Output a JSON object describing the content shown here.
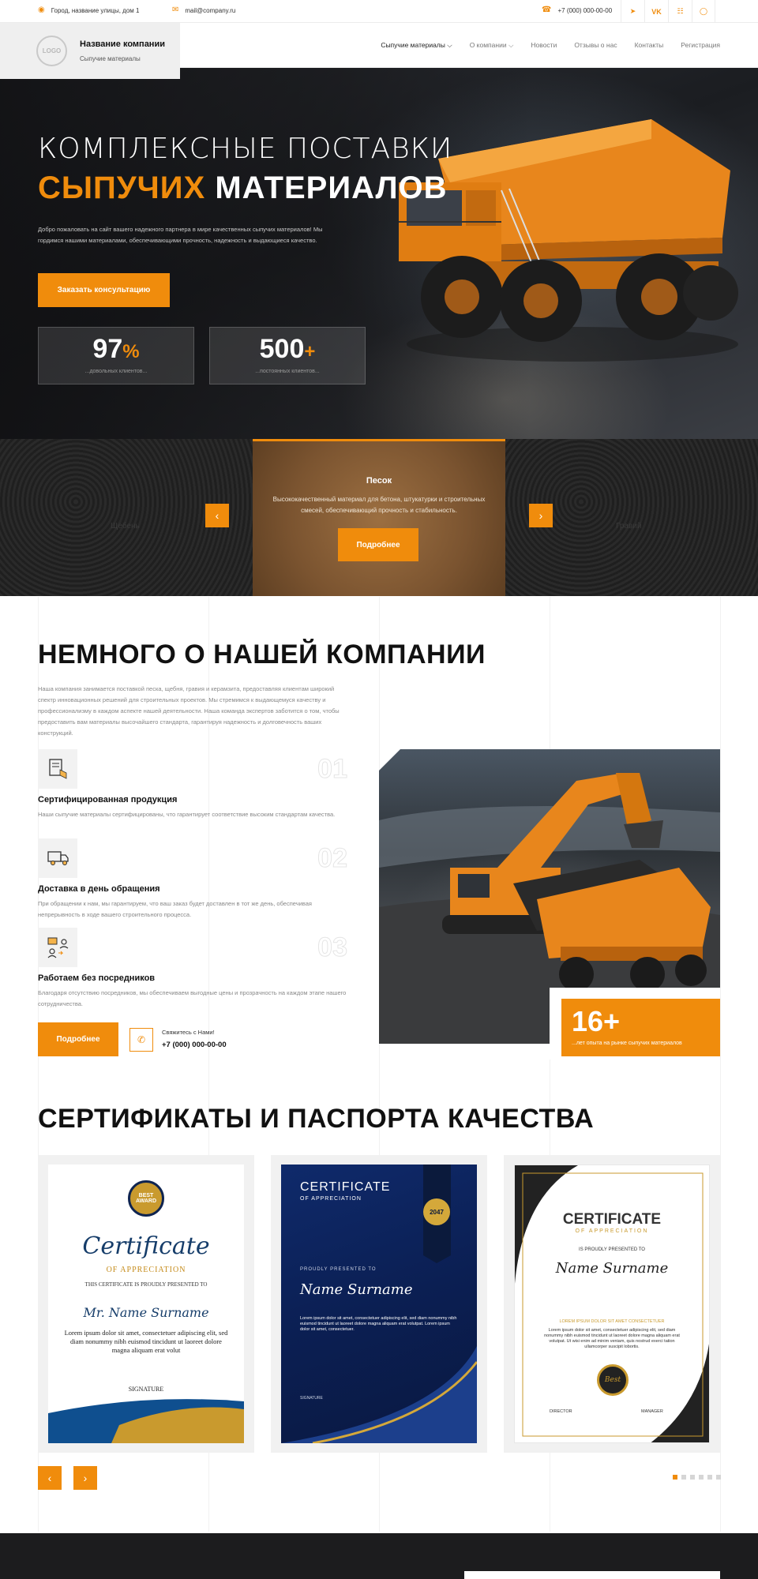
{
  "topbar": {
    "address": "Город, название улицы, дом 1",
    "email": "mail@company.ru",
    "phone": "+7 (000) 000-00-00",
    "social": [
      "telegram-icon",
      "vk-icon",
      "odnoklassniki-icon",
      "whatsapp-icon"
    ]
  },
  "brand": {
    "logo_text": "LOGO",
    "name": "Название компании",
    "tagline": "Сыпучие материалы"
  },
  "menu": {
    "items": [
      {
        "label": "Сыпучие материалы",
        "dropdown": true,
        "active": true
      },
      {
        "label": "О компании",
        "dropdown": true,
        "active": false
      },
      {
        "label": "Новости",
        "dropdown": false,
        "active": false
      },
      {
        "label": "Отзывы о нас",
        "dropdown": false,
        "active": false
      },
      {
        "label": "Контакты",
        "dropdown": false,
        "active": false
      },
      {
        "label": "Регистрация",
        "dropdown": false,
        "active": false
      }
    ]
  },
  "hero": {
    "title_line1": "КОМПЛЕКСНЫЕ ПОСТАВКИ",
    "title_accent": "СЫПУЧИХ",
    "title_rest": " МАТЕРИАЛОВ",
    "description": "Добро пожаловать на сайт вашего надежного партнера в мире качественных сыпучих материалов! Мы гордимся нашими материалами, обеспечивающими прочность, надежность и выдающиеся качество.",
    "cta": "Заказать консультацию",
    "stats": [
      {
        "value": "97",
        "suffix": "%",
        "label": "...довольных клиентов..."
      },
      {
        "value": "500",
        "suffix": "+",
        "label": "...постоянных клиентов..."
      }
    ]
  },
  "materials": {
    "active": {
      "title": "Песок",
      "text": "Высококачественный материал для бетона, штукатурки и строительных смесей, обеспечивающий прочность и стабильность.",
      "button": "Подробнее"
    },
    "left_ghost": "Щебень",
    "right_ghost": "Гравий",
    "prev": "‹",
    "next": "›"
  },
  "about": {
    "heading": "НЕМНОГО О НАШЕЙ КОМПАНИИ",
    "text": "Наша компания занимается поставкой песка, щебня, гравия и керамзита, предоставляя клиентам широкий спектр инновационных решений для строительных проектов. Мы стремимся к выдающемуся качеству и профессионализму в каждом аспекте нашей деятельности. Наша команда экспертов заботится о том, чтобы предоставить вам материалы высочайшего стандарта, гарантируя надежность и долговечность ваших конструкций.",
    "features": [
      {
        "num": "01",
        "icon": "certificate-box-icon",
        "title": "Сертифицированная продукция",
        "text": "Наши сыпучие материалы сертифицированы, что гарантирует соответствие высоким стандартам качества."
      },
      {
        "num": "02",
        "icon": "delivery-truck-icon",
        "title": "Доставка в день обращения",
        "text": "При обращении к нам, мы гарантируем, что ваш заказ будет доставлен в тот же день, обеспечивая непрерывность в ходе вашего строительного процесса."
      },
      {
        "num": "03",
        "icon": "no-middleman-icon",
        "title": "Работаем без посредников",
        "text": "Благодаря отсутствию посредников, мы обеспечиваем выгодные цены и прозрачность на каждом этапе нашего сотрудничества."
      }
    ],
    "button": "Подробнее",
    "contact_label": "Свяжитесь с Нами!",
    "contact_phone": "+7 (000) 000-00-00",
    "experience_value": "16+",
    "experience_label": "...лет опыта на рынке сыпучих материалов"
  },
  "certificates": {
    "heading": "СЕРТИФИКАТЫ И ПАСПОРТА КАЧЕСТВА",
    "items": [
      {
        "badge": "BEST AWARD",
        "title": "Certificate",
        "sub": "OF APPRECIATION",
        "presented": "THIS CERTIFICATE IS PROUDLY PRESENTED TO",
        "name": "Mr. Name Surname",
        "body": "Lorem ipsum dolor sit amet, consectetuer adipiscing elit, sed diam nonummy nibh euismod tincidunt ut laoreet dolore magna aliquam erat volut",
        "sign": "SIGNATURE"
      },
      {
        "title": "CERTIFICATE",
        "sub": "OF APPRECIATION",
        "year": "2047",
        "presented": "PROUDLY PRESENTED TO",
        "name": "Name Surname",
        "body": "Lorem ipsum dolor sit amet, consectetuer adipiscing elit, sed diam nonummy nibh euismod tincidunt ut laoreet dolore magna aliquam erat volutpat. Lorem ipsum dolor sit amet, consectetuer.",
        "sign": "SIGNATURE"
      },
      {
        "title": "CERTIFICATE",
        "sub": "OF APPRECIATION",
        "presented": "IS PROUDLY PRESENTED TO",
        "name": "Name Surname",
        "lorem_head": "LOREM IPSUM DOLOR SIT AMET CONSECTETUER",
        "body": "Lorem ipsum dolor sit amet, consectetuer adipiscing elit, sed diam nonummy nibh euismod tincidunt ut laoreet dolore magna aliquam erat volutpat. Ut wisi enim ad minim veniam, quis nostrud exerci tation ullamcorper suscipit lobortis.",
        "medal": "Best",
        "sign_left": "DIRECTOR",
        "sign_right": "MANAGER"
      }
    ],
    "prev": "‹",
    "next": "›",
    "dots": 6,
    "active_dot": 0
  },
  "colors": {
    "accent": "#f08c0c",
    "dark": "#1c1c1e",
    "text": "#111111",
    "muted": "#888888"
  }
}
